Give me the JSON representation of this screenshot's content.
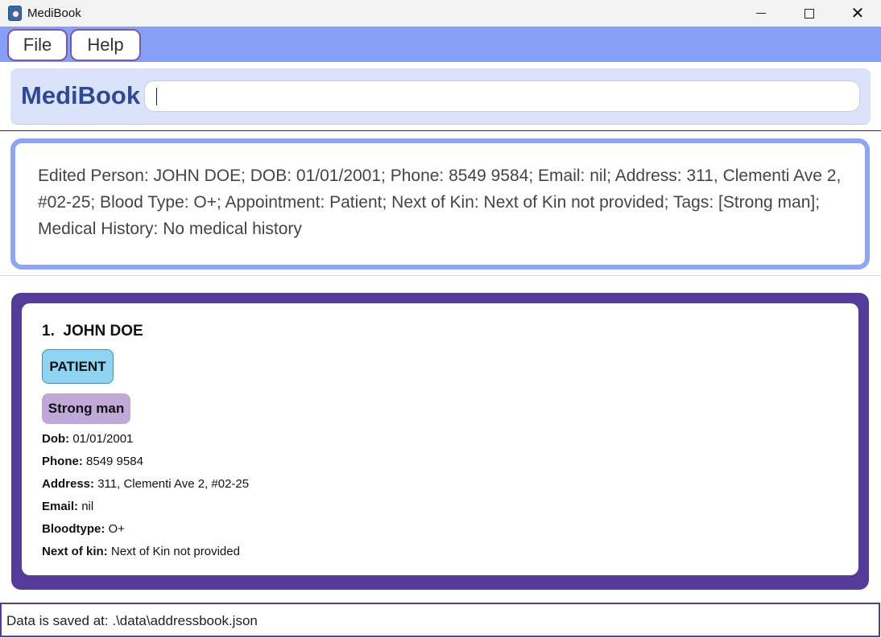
{
  "window": {
    "title": "MediBook",
    "controls": {
      "minimize": "minimize-icon",
      "maximize": "maximize-icon",
      "close": "close-icon"
    }
  },
  "menu": {
    "items": [
      {
        "label": "File"
      },
      {
        "label": "Help"
      }
    ]
  },
  "commandbar": {
    "brand": "MediBook",
    "input_value": ""
  },
  "result": {
    "message": "Edited Person: JOHN DOE; DOB: 01/01/2001; Phone: 8549 9584; Email: nil; Address: 311, Clementi Ave 2, #02-25; Blood Type: O+; Appointment: Patient; Next of Kin: Next of Kin not provided; Tags: [Strong man]; Medical History: No medical history"
  },
  "persons": [
    {
      "index": "1.",
      "name": "JOHN DOE",
      "role": "PATIENT",
      "tags": [
        "Strong man"
      ],
      "fields": [
        {
          "label": "Dob:",
          "value": "01/01/2001"
        },
        {
          "label": "Phone:",
          "value": "8549 9584"
        },
        {
          "label": "Address:",
          "value": "311, Clementi Ave 2, #02-25"
        },
        {
          "label": "Email:",
          "value": "nil"
        },
        {
          "label": "Bloodtype:",
          "value": "O+"
        },
        {
          "label": "Next of kin:",
          "value": "Next of Kin not provided"
        }
      ]
    }
  ],
  "status": {
    "text": "Data is saved at: .\\data\\addressbook.json"
  },
  "colors": {
    "menubar": "#86a0f8",
    "card_border": "#553c9a",
    "result_border": "#8ca5fa",
    "role_badge": "#8ed3ef",
    "tag_badge": "#c0a9d9",
    "brand_text": "#2e4a96"
  }
}
